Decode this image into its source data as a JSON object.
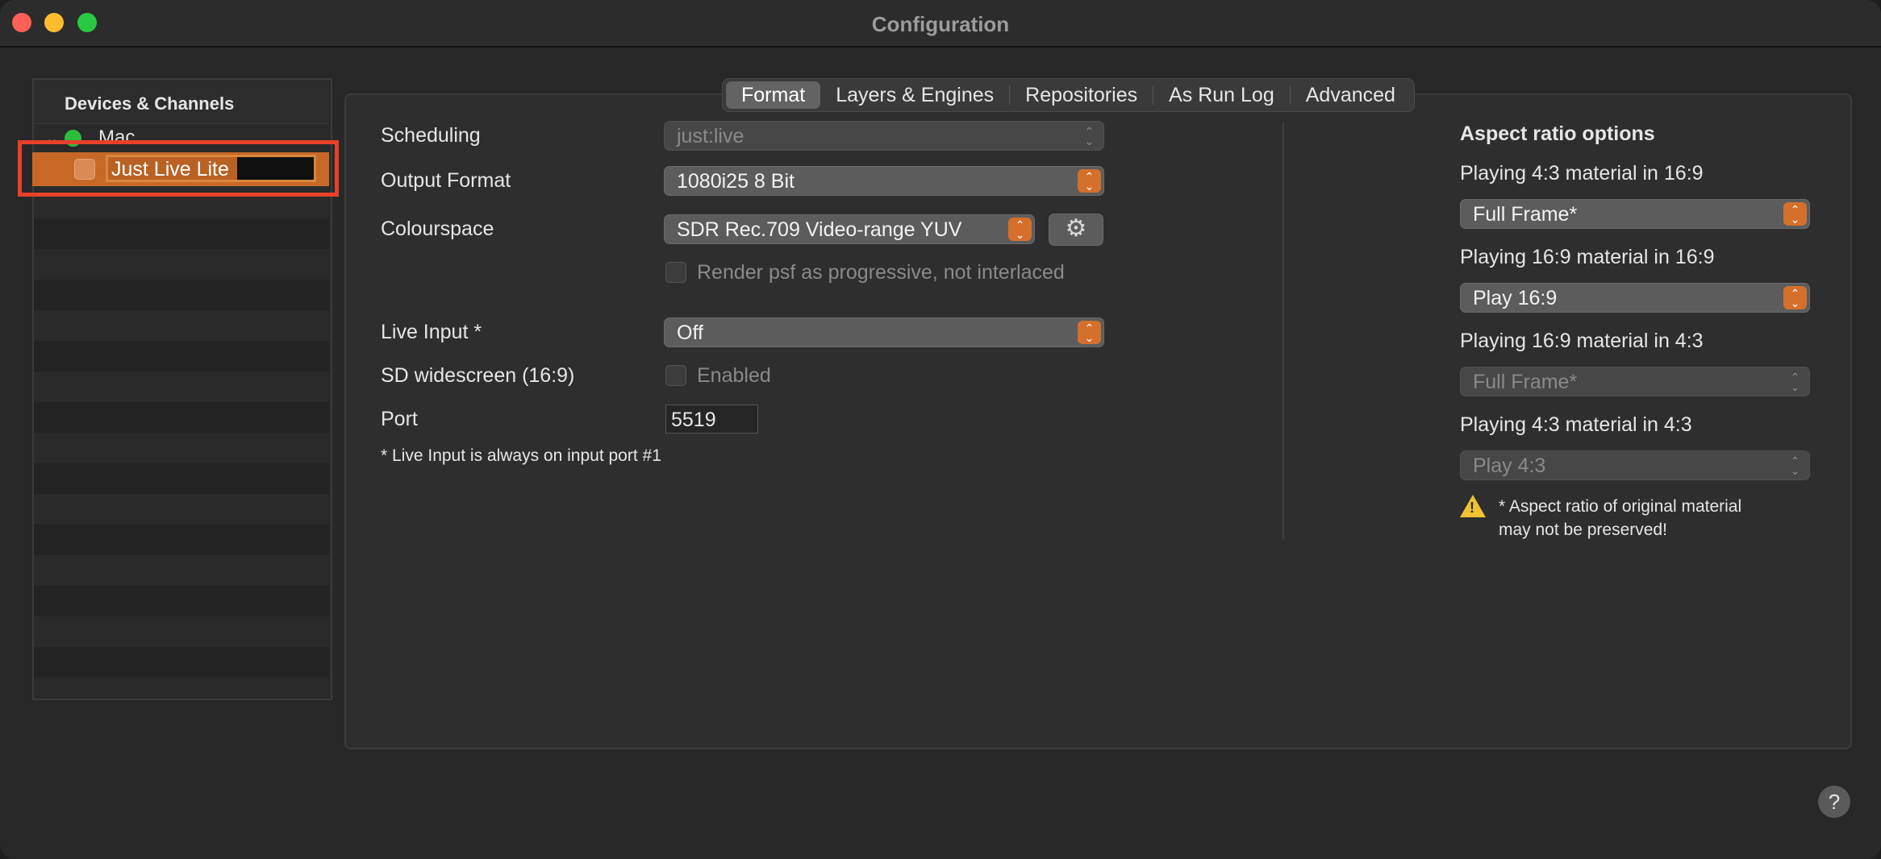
{
  "window": {
    "title": "Configuration"
  },
  "sidebar": {
    "header": "Devices & Channels",
    "device": {
      "name": "Mac",
      "status_color": "#2dbd3c"
    },
    "channel": {
      "name": "Just Live Lite"
    }
  },
  "tabs": [
    "Format",
    "Layers & Engines",
    "Repositories",
    "As Run Log",
    "Advanced"
  ],
  "active_tab": "Format",
  "format": {
    "scheduling": {
      "label": "Scheduling",
      "value": "just:live"
    },
    "output_format": {
      "label": "Output Format",
      "value": "1080i25 8 Bit"
    },
    "colourspace": {
      "label": "Colourspace",
      "value": "SDR Rec.709 Video-range YUV"
    },
    "render_psf": {
      "label": "Render psf as progressive, not interlaced",
      "checked": false
    },
    "live_input": {
      "label": "Live Input *",
      "value": "Off"
    },
    "sd_widescreen": {
      "label": "SD widescreen (16:9)",
      "checkbox_label": "Enabled",
      "checked": false
    },
    "port": {
      "label": "Port",
      "value": "5519"
    },
    "footnote": "* Live Input is always on input port #1"
  },
  "aspect": {
    "title": "Aspect ratio options",
    "options": [
      {
        "label": "Playing 4:3 material in 16:9",
        "value": "Full Frame*"
      },
      {
        "label": "Playing 16:9 material in 16:9",
        "value": "Play 16:9"
      },
      {
        "label": "Playing 16:9 material in 4:3",
        "value": "Full Frame*"
      },
      {
        "label": "Playing 4:3 material in 4:3",
        "value": "Play 4:3"
      }
    ],
    "warning_line1": "* Aspect ratio of original material",
    "warning_line2": "may not be preserved!"
  },
  "help": "?",
  "colors": {
    "accent": "#d4702c",
    "selection": "#c76826",
    "highlight_box": "#e8402a"
  }
}
